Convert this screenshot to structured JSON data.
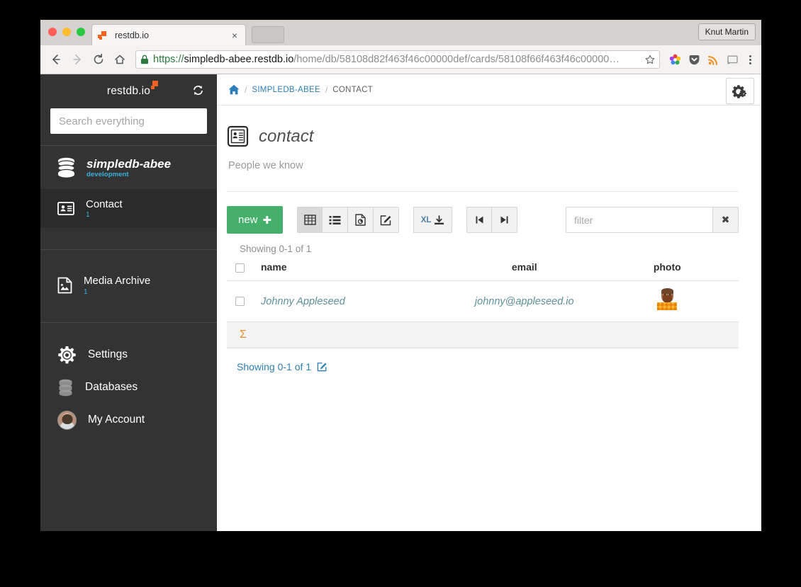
{
  "browser": {
    "tab": {
      "title": "restdb.io",
      "close_label": "×"
    },
    "profile": "Knut Martin",
    "url": {
      "scheme": "https://",
      "host": "simpledb-abee.restdb.io",
      "path": "/home/db/58108d82f463f46c00000def/cards/58108f66f463f46c00000…"
    },
    "nav": {
      "back": "back-arrow",
      "forward": "forward-arrow",
      "reload": "reload",
      "home": "home"
    },
    "extensions": [
      "color-wheel-icon",
      "pocket-icon",
      "rss-icon",
      "cast-icon",
      "chrome-menu-icon"
    ]
  },
  "sidebar": {
    "brand": "restdb.io",
    "refresh_label": "refresh",
    "search": {
      "placeholder": "Search everything",
      "value": ""
    },
    "database": {
      "name": "simpledb-abee",
      "environment": "development"
    },
    "collections": [
      {
        "label": "Contact",
        "count": "1",
        "icon": "contact-card-icon",
        "active": true
      },
      {
        "label": "Media Archive",
        "count": "1",
        "icon": "media-file-icon",
        "active": false
      }
    ],
    "links": [
      {
        "label": "Settings",
        "icon": "gear-icon"
      },
      {
        "label": "Databases",
        "icon": "database-icon"
      },
      {
        "label": "My Account",
        "icon": "avatar-icon"
      }
    ]
  },
  "breadcrumb": {
    "home": "home-icon",
    "sep": "/",
    "items": [
      "SIMPLEDB-ABEE",
      "CONTACT"
    ]
  },
  "page": {
    "title": "contact",
    "subtitle": "People we know",
    "settings_button": "gears-icon"
  },
  "toolbar": {
    "new_label": "new",
    "new_plus": "✚",
    "views": [
      {
        "name": "grid-view",
        "icon": "table-grid-icon",
        "active": true
      },
      {
        "name": "list-view",
        "icon": "list-icon",
        "active": false
      },
      {
        "name": "report-view",
        "icon": "report-doc-icon",
        "active": false
      },
      {
        "name": "edit-view",
        "icon": "pencil-square-icon",
        "active": false
      }
    ],
    "export": {
      "label": "XL",
      "icon": "download-icon"
    },
    "paging": [
      {
        "name": "first-page",
        "icon": "step-backward-icon"
      },
      {
        "name": "last-page",
        "icon": "step-forward-icon"
      }
    ],
    "filter": {
      "placeholder": "filter",
      "value": "",
      "clear_label": "✖"
    }
  },
  "table": {
    "showing_top": "Showing 0-1 of 1",
    "showing_bottom": "Showing 0-1 of 1",
    "columns": [
      "name",
      "email",
      "photo"
    ],
    "rows": [
      {
        "name": "Johnny Appleseed",
        "email": "johnny@appleseed.io",
        "photo": "bearded-man-thumbnail"
      }
    ],
    "summary_symbol": "Σ"
  },
  "colors": {
    "accent_orange": "#f26322",
    "brand_green": "#45b06b",
    "link_blue": "#2c7fb8",
    "env_blue": "#37b3e0",
    "sidebar_bg": "#333333",
    "cell_link": "#5d9099"
  }
}
